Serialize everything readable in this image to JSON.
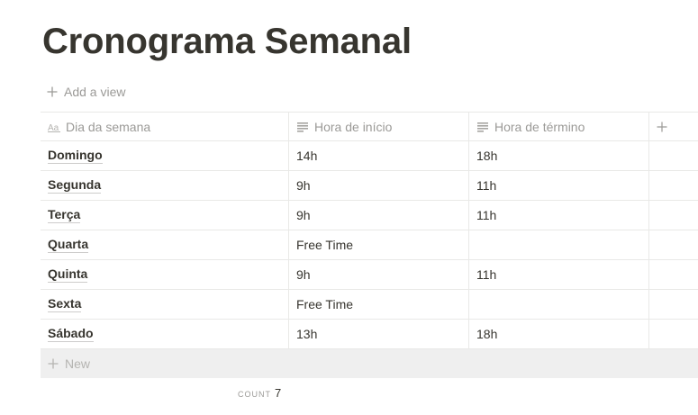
{
  "page": {
    "title": "Cronograma Semanal"
  },
  "views": {
    "add_view_label": "Add a view"
  },
  "table": {
    "columns": [
      {
        "label": "Dia da semana",
        "icon": "text-aa-icon"
      },
      {
        "label": "Hora de início",
        "icon": "text-lines-icon"
      },
      {
        "label": "Hora de término",
        "icon": "text-lines-icon"
      }
    ],
    "add_column_icon": "plus-icon",
    "rows": [
      {
        "day": "Domingo",
        "start": "14h",
        "end": "18h"
      },
      {
        "day": "Segunda",
        "start": "9h",
        "end": "11h"
      },
      {
        "day": "Terça",
        "start": "9h",
        "end": "11h"
      },
      {
        "day": "Quarta",
        "start": "Free Time",
        "end": ""
      },
      {
        "day": "Quinta",
        "start": "9h",
        "end": "11h"
      },
      {
        "day": "Sexta",
        "start": "Free Time",
        "end": ""
      },
      {
        "day": "Sábado",
        "start": "13h",
        "end": "18h"
      }
    ],
    "new_row_label": "New"
  },
  "footer": {
    "count_label": "COUNT",
    "count_value": "7"
  },
  "colors": {
    "text": "#37352f",
    "muted": "#9b9a97",
    "border": "#e9e9e7",
    "new_row_bg": "#efefef"
  }
}
